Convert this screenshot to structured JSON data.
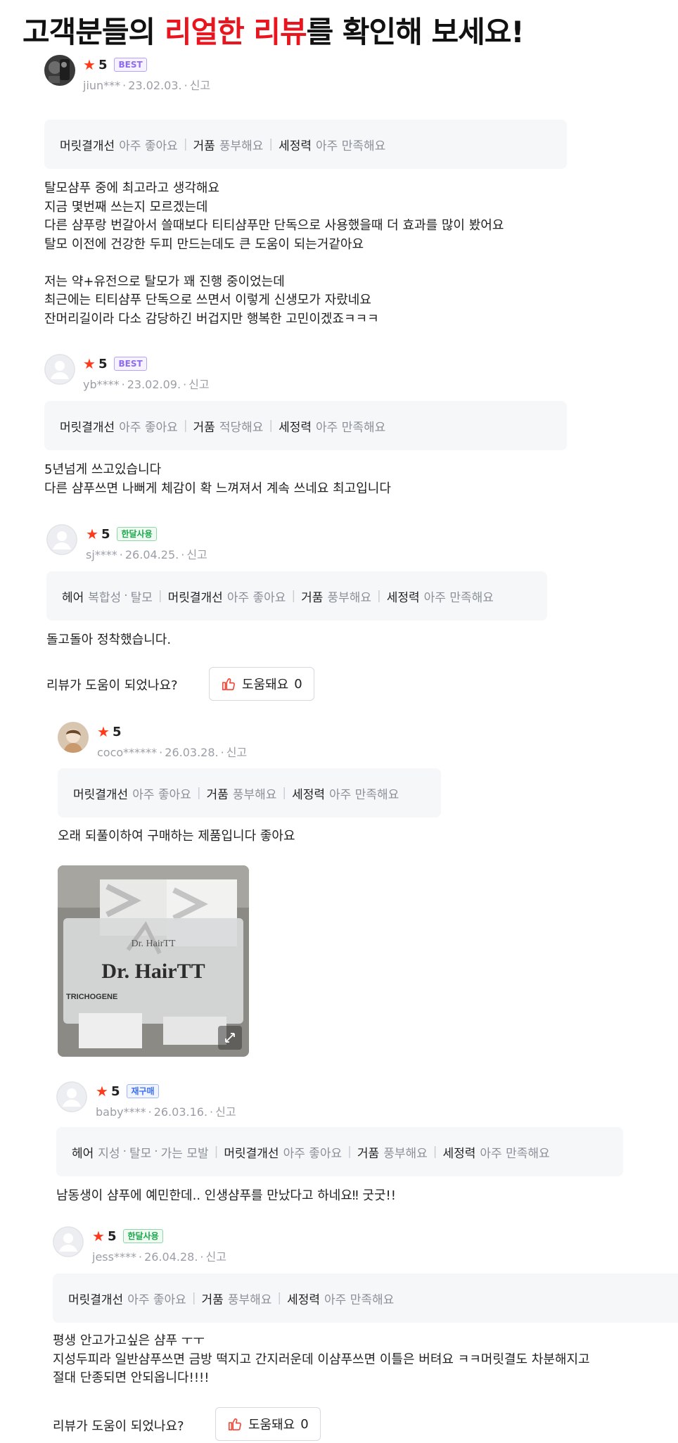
{
  "headline": {
    "part1": "고객분들의 ",
    "highlight": "리얼한 리뷰",
    "part2": "를 확인해 보세요!"
  },
  "report_label": "신고",
  "helpful": {
    "question": "리뷰가 도움이 되었나요?",
    "button_label": "도움돼요",
    "count": "0"
  },
  "reviews": [
    {
      "rating": "5",
      "badge": "BEST",
      "user": "jiun***",
      "date": "23.02.03.",
      "options": [
        {
          "key": "머릿결개선",
          "value": "아주 좋아요"
        },
        {
          "key": "거품",
          "value": "풍부해요"
        },
        {
          "key": "세정력",
          "value": "아주 만족해요"
        }
      ],
      "text": "탈모샴푸 중에 최고라고 생각해요\n지금 몇번째 쓰는지 모르겠는데\n다른 샴푸랑 번갈아서 쓸때보다 티티샴푸만 단독으로 사용했을때 더 효과를 많이 봤어요\n탈모 이전에 건강한 두피 만드는데도 큰 도움이 되는거같아요\n\n저는 약+유전으로 탈모가 꽤 진행 중이었는데\n최근에는 티티샴푸 단독으로 쓰면서 이렇게 신생모가 자랐네요\n잔머리길이라 다소 감당하긴 버겁지만 행복한 고민이겠죠ㅋㅋㅋ"
    },
    {
      "rating": "5",
      "badge": "BEST",
      "user": "yb****",
      "date": "23.02.09.",
      "options": [
        {
          "key": "머릿결개선",
          "value": "아주 좋아요"
        },
        {
          "key": "거품",
          "value": "적당해요"
        },
        {
          "key": "세정력",
          "value": "아주 만족해요"
        }
      ],
      "text": "5년넘게 쓰고있습니다\n다른 샴푸쓰면 나뻐게 체감이 확 느껴져서 계속 쓰네요 최고입니다"
    },
    {
      "rating": "5",
      "badge": "한달사용",
      "user": "sj****",
      "date": "26.04.25.",
      "hair": {
        "key": "헤어",
        "values": [
          "복합성",
          "탈모"
        ]
      },
      "options": [
        {
          "key": "머릿결개선",
          "value": "아주 좋아요"
        },
        {
          "key": "거품",
          "value": "풍부해요"
        },
        {
          "key": "세정력",
          "value": "아주 만족해요"
        }
      ],
      "text": "돌고돌아 정착했습니다."
    },
    {
      "rating": "5",
      "user": "coco******",
      "date": "26.03.28.",
      "options": [
        {
          "key": "머릿결개선",
          "value": "아주 좋아요"
        },
        {
          "key": "거품",
          "value": "풍부해요"
        },
        {
          "key": "세정력",
          "value": "아주 만족해요"
        }
      ],
      "text": "오래 되풀이하여 구매하는 제품입니다 좋아요",
      "photo": {
        "brand": "Dr. HairTT",
        "sub": "TRICHOGENE"
      }
    },
    {
      "rating": "5",
      "badge": "재구매",
      "user": "baby****",
      "date": "26.03.16.",
      "hair": {
        "key": "헤어",
        "values": [
          "지성",
          "탈모",
          "가는 모발"
        ]
      },
      "options": [
        {
          "key": "머릿결개선",
          "value": "아주 좋아요"
        },
        {
          "key": "거품",
          "value": "풍부해요"
        },
        {
          "key": "세정력",
          "value": "아주 만족해요"
        }
      ],
      "text": "남동생이 샴푸에 예민한데.. 인생샴푸를 만났다고 하네요‼ 굿굿!!"
    },
    {
      "rating": "5",
      "badge": "한달사용",
      "user": "jess****",
      "date": "26.04.28.",
      "options": [
        {
          "key": "머릿결개선",
          "value": "아주 좋아요"
        },
        {
          "key": "거품",
          "value": "풍부해요"
        },
        {
          "key": "세정력",
          "value": "아주 만족해요"
        }
      ],
      "text": "평생 안고가고싶은 샴푸 ㅜㅜ\n지성두피라 일반샴푸쓰면 금방 떡지고 간지러운데 이샴푸쓰면 이틀은 버텨요 ㅋㅋ머릿결도 차분해지고\n절대 단종되면 안되옵니다!!!!"
    }
  ],
  "colors": {
    "headline_highlight": "#e8141e",
    "star": "#ff3a1a",
    "badge_best": "#8e6cf0",
    "badge_month": "#1aa84b",
    "badge_rebuy": "#3d6ff5",
    "option_bg": "#f6f7f9"
  }
}
